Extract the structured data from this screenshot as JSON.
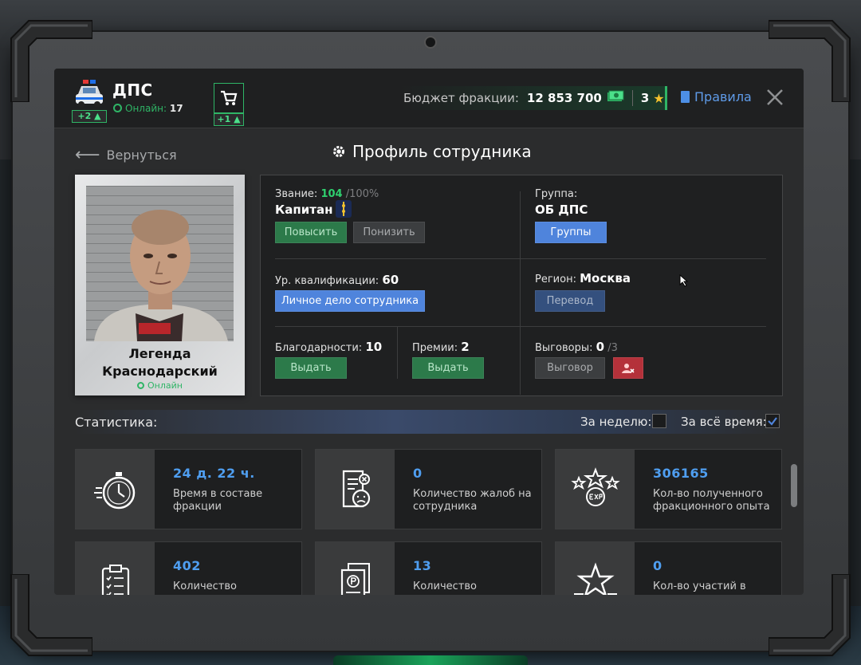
{
  "header": {
    "faction_name": "ДПС",
    "faction_badge": "+2",
    "online_label": "Онлайн:",
    "online_count": "17",
    "shop_badge": "+1",
    "budget_label": "Бюджет фракции:",
    "budget_value": "12 853 700",
    "stars": "3",
    "rules_label": "Правила"
  },
  "nav": {
    "back_label": "Вернуться",
    "page_title": "Профиль сотрудника"
  },
  "profile": {
    "name_line1": "Легенда",
    "name_line2": "Краснодарский",
    "status": "Онлайн"
  },
  "rank": {
    "label": "Звание:",
    "value": "104",
    "max": "/100%",
    "name": "Капитан",
    "promote": "Повысить",
    "demote": "Понизить"
  },
  "group": {
    "label": "Группа:",
    "value": "ОБ ДПС",
    "button": "Группы"
  },
  "qualification": {
    "label": "Ур. квалификации:",
    "value": "60",
    "button": "Личное дело сотрудника"
  },
  "region": {
    "label": "Регион:",
    "value": "Москва",
    "button": "Перевод"
  },
  "thanks": {
    "label": "Благодарности:",
    "value": "10",
    "button": "Выдать"
  },
  "bonuses": {
    "label": "Премии:",
    "value": "2",
    "button": "Выдать"
  },
  "reprimands": {
    "label": "Выговоры:",
    "value": "0",
    "max": "/3",
    "button": "Выговор"
  },
  "stats": {
    "title": "Статистика:",
    "week_label": "За неделю:",
    "week_checked": false,
    "all_time_label": "За всё время:",
    "all_time_checked": true,
    "cards": [
      {
        "icon": "stopwatch-icon",
        "value": "24 д. 22 ч.",
        "desc": "Время в составе фракции"
      },
      {
        "icon": "complaint-document-icon",
        "value": "0",
        "desc": "Количество жалоб на сотрудника"
      },
      {
        "icon": "exp-stars-icon",
        "value": "306165",
        "desc": "Кол-во полученного фракционного опыта"
      },
      {
        "icon": "clipboard-checklist-icon",
        "value": "402",
        "desc": "Количество"
      },
      {
        "icon": "ruble-documents-icon",
        "value": "13",
        "desc": "Количество"
      },
      {
        "icon": "star-badge-icon",
        "value": "0",
        "desc": "Кол-во участий в"
      }
    ]
  },
  "colors": {
    "accent_green": "#2fb566",
    "accent_blue": "#4f84dc",
    "value_blue": "#4f9ef0",
    "danger_red": "#b4313a",
    "star_gold": "#f2c12e"
  }
}
